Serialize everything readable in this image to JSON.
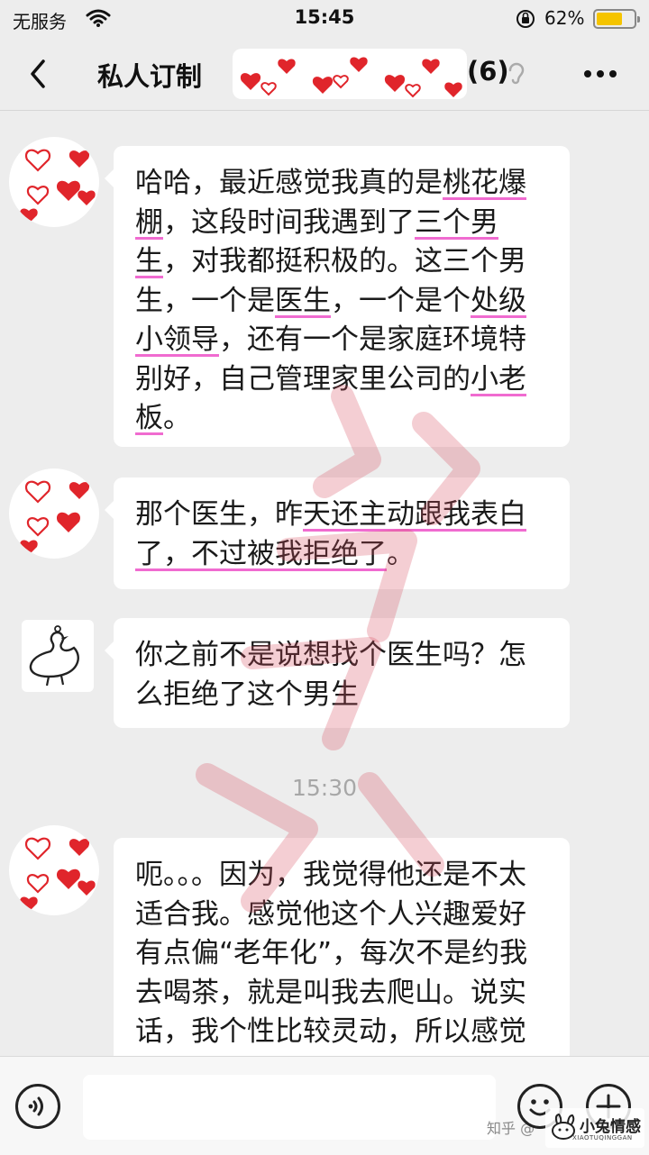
{
  "status_bar": {
    "carrier": "无服务",
    "time": "15:45",
    "battery_percent": "62%",
    "battery_level": 0.62,
    "icons": [
      "wifi-icon",
      "orientation-lock-icon",
      "battery-icon"
    ]
  },
  "header": {
    "title": "私人订制",
    "member_count": "(6)",
    "icons": [
      "back-chevron-icon",
      "ear-icon",
      "more-dots-icon"
    ]
  },
  "messages": [
    {
      "sender": "hearts-avatar",
      "segments": [
        {
          "text": "哈哈，最近感觉我真的是"
        },
        {
          "text": "桃花爆棚",
          "highlight": true
        },
        {
          "text": "，这段时间我遇到了"
        },
        {
          "text": "三个男生",
          "highlight": true
        },
        {
          "text": "，对我都挺积极的。这三个男生，一个是"
        },
        {
          "text": "医生",
          "highlight": true
        },
        {
          "text": "，一个是个"
        },
        {
          "text": "处级小领导",
          "highlight": true
        },
        {
          "text": "，还有一个是家庭环境特别好，自己管理家里公司的"
        },
        {
          "text": "小老板",
          "highlight": true
        },
        {
          "text": "。"
        }
      ]
    },
    {
      "sender": "hearts-avatar",
      "segments": [
        {
          "text": "那个医生，昨"
        },
        {
          "text": "天还主动跟我表白了，不过被我拒绝了",
          "highlight": true
        },
        {
          "text": "。"
        }
      ]
    },
    {
      "sender": "duck-avatar",
      "segments": [
        {
          "text": "你之前不是说想找个医生吗？怎么拒绝了这个男生"
        }
      ]
    },
    {
      "sender": "hearts-avatar",
      "segments": [
        {
          "text": "呃。。。因为，我觉得他还是不太适合我。感觉他这个人兴趣爱好有点偏“老年化”，每次不是约我去喝茶，就是叫我去爬山。说实话，我个性比较灵动，所以感觉在一起时间长"
        }
      ]
    }
  ],
  "timestamp": "15:30",
  "input_bar": {
    "placeholder": "",
    "icons": [
      "voice-icon",
      "emoji-icon",
      "plus-icon"
    ]
  },
  "watermarks": {
    "zhihu": "知乎 @",
    "brand_main": "小兔情感",
    "brand_sub": "XIAOTUQINGGAN"
  },
  "colors": {
    "background": "#ededed",
    "bubble": "#ffffff",
    "highlight_underline": "#f06bd0",
    "heart_red": "#e0252b",
    "battery": "#f5c400"
  }
}
